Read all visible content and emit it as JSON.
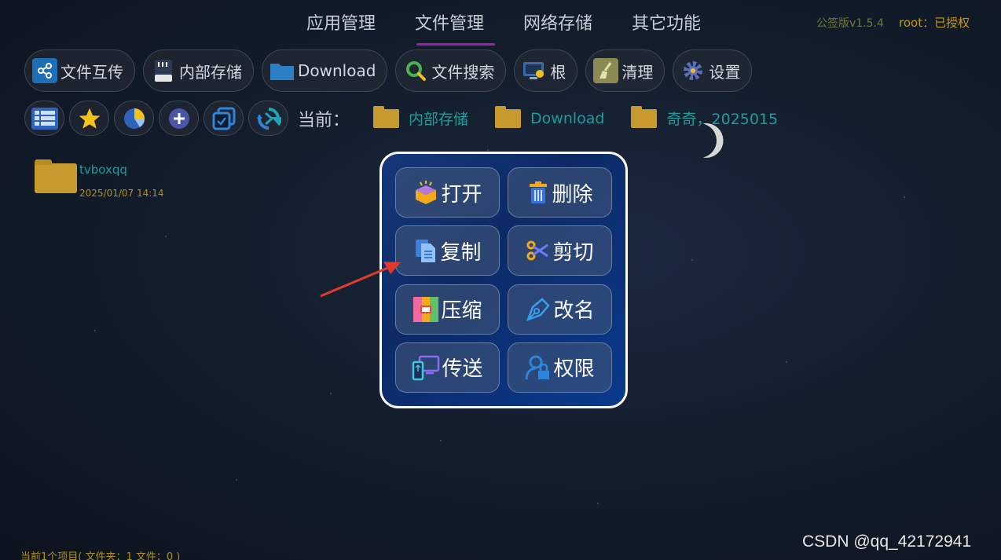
{
  "tabs": [
    {
      "label": "应用管理",
      "active": false
    },
    {
      "label": "文件管理",
      "active": true
    },
    {
      "label": "网络存储",
      "active": false
    },
    {
      "label": "其它功能",
      "active": false
    }
  ],
  "header": {
    "version": "公签版v1.5.4",
    "auth": "root：已授权"
  },
  "toolbar": [
    {
      "label": "文件互传",
      "icon": "share-icon"
    },
    {
      "label": "内部存储",
      "icon": "sd-card-icon"
    },
    {
      "label": "Download",
      "icon": "folder-icon"
    },
    {
      "label": "文件搜索",
      "icon": "search-icon"
    },
    {
      "label": "根",
      "icon": "root-icon"
    },
    {
      "label": "清理",
      "icon": "broom-icon"
    },
    {
      "label": "设置",
      "icon": "gear-icon"
    }
  ],
  "breadcrumb": {
    "label": "当前：",
    "items": [
      "内部存储",
      "Download",
      "奇奇，2025015"
    ]
  },
  "file": {
    "name": "tvboxqq",
    "date": "2025/01/07 14:14"
  },
  "context_menu": [
    {
      "label": "打开",
      "icon": "open-box-icon"
    },
    {
      "label": "删除",
      "icon": "trash-icon"
    },
    {
      "label": "复制",
      "icon": "copy-icon"
    },
    {
      "label": "剪切",
      "icon": "scissors-icon"
    },
    {
      "label": "压缩",
      "icon": "archive-icon"
    },
    {
      "label": "改名",
      "icon": "pen-icon"
    },
    {
      "label": "传送",
      "icon": "transfer-icon"
    },
    {
      "label": "权限",
      "icon": "permission-icon"
    }
  ],
  "status": "当前1个项目( 文件夹：1  文件：0 )",
  "watermark": "CSDN @qq_42172941",
  "colors": {
    "accent_tab": "#a020a8",
    "breadcrumb": "#1b9e9a",
    "menu_bg": "#0d2a66",
    "folder": "#c69a2e"
  }
}
